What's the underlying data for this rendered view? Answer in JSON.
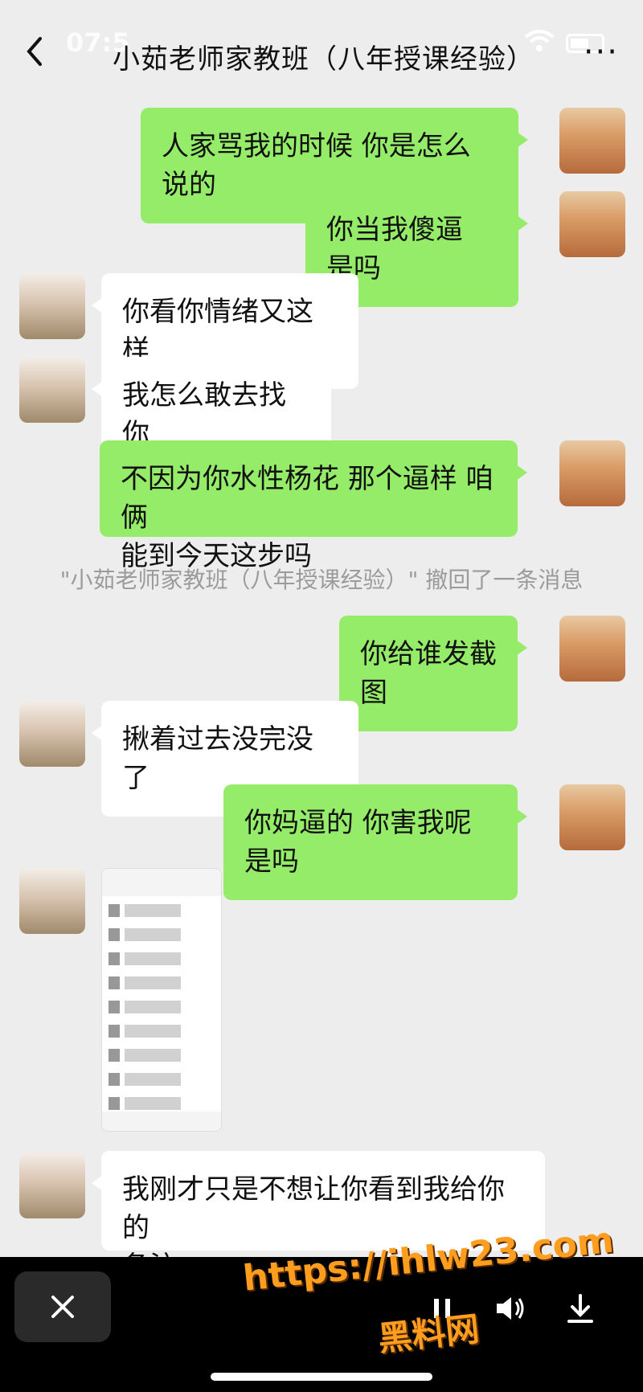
{
  "status": {
    "time": "07:5"
  },
  "header": {
    "title": "小茹老师家教班（八年授课经验）",
    "more": "···"
  },
  "messages": [
    {
      "side": "sent",
      "text": "人家骂我的时候 你是怎么说的"
    },
    {
      "side": "sent",
      "text": "你当我傻逼 是吗"
    },
    {
      "side": "recv",
      "text": "你看你情绪又这样"
    },
    {
      "side": "recv",
      "text": "我怎么敢去找你"
    },
    {
      "side": "sent",
      "text": "不因为你水性杨花 那个逼样 咱俩\n能到今天这步吗"
    },
    {
      "side": "sent",
      "text": "你给谁发截图"
    },
    {
      "side": "recv",
      "text": "揪着过去没完没了"
    },
    {
      "side": "sent",
      "text": "你妈逼的 你害我呢是吗"
    },
    {
      "side": "recv",
      "text": "我刚才只是不想让你看到我给你的\n备注"
    }
  ],
  "system_msg": "\"小茹老师家教班（八年授课经验）\" 撤回了一条消息",
  "watermark": {
    "url": "https://ihlw23.com",
    "name": "黑料网"
  },
  "colors": {
    "sent": "#95ec69",
    "recv": "#ffffff",
    "bg": "#ededed"
  }
}
